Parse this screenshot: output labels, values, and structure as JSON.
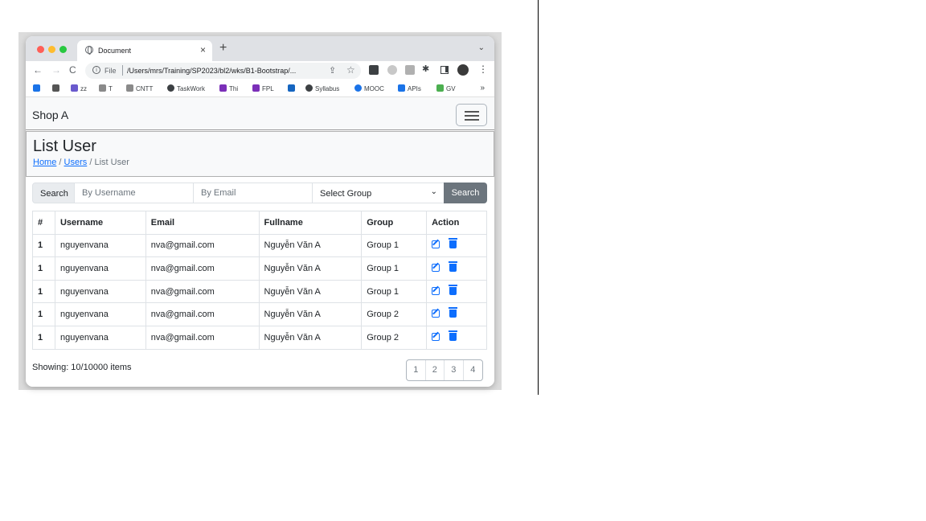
{
  "browser": {
    "tab_title": "Document",
    "new_tab": "+",
    "close": "×",
    "tab_menu": "⌄",
    "nav": {
      "back": "←",
      "forward": "→",
      "reload": "C"
    },
    "omnibox": {
      "info": "i",
      "scheme": "File",
      "url": "/Users/mrs/Training/SP2023/bl2/wks/B1-Bootstrap/..."
    },
    "bookmarks": [
      {
        "label": "",
        "color": "#1a73e8"
      },
      {
        "label": "",
        "color": "#555555"
      },
      {
        "label": "zz",
        "color": "#6a5acd"
      },
      {
        "label": "T",
        "color": "#6f6f6f"
      },
      {
        "label": "CNTT",
        "color": "#6f6f6f"
      },
      {
        "label": "TaskWork",
        "color": "#3c4043"
      },
      {
        "label": "Thi",
        "color": "#7b2fb8"
      },
      {
        "label": "FPL",
        "color": "#7b2fb8"
      },
      {
        "label": "",
        "color": "#1565c0"
      },
      {
        "label": "Syllabus",
        "color": "#3c4043"
      },
      {
        "label": "MOOC",
        "color": "#1a73e8"
      },
      {
        "label": "APIs",
        "color": "#1a73e8"
      },
      {
        "label": "GV",
        "color": "#4caf50"
      }
    ],
    "bookmarks_more": "»"
  },
  "navbar": {
    "brand": "Shop A"
  },
  "header": {
    "title": "List User",
    "breadcrumb": {
      "home": "Home",
      "users": "Users",
      "current": "List User",
      "sep": "/"
    }
  },
  "search": {
    "label": "Search",
    "username_placeholder": "By Username",
    "email_placeholder": "By Email",
    "group_selected": "Select Group",
    "button": "Search"
  },
  "table": {
    "headers": [
      "#",
      "Username",
      "Email",
      "Fullname",
      "Group",
      "Action"
    ],
    "rows": [
      {
        "num": "1",
        "username": "nguyenvana",
        "email": "nva@gmail.com",
        "fullname": "Nguyễn Văn A",
        "group": "Group 1"
      },
      {
        "num": "1",
        "username": "nguyenvana",
        "email": "nva@gmail.com",
        "fullname": "Nguyễn Văn A",
        "group": "Group 1"
      },
      {
        "num": "1",
        "username": "nguyenvana",
        "email": "nva@gmail.com",
        "fullname": "Nguyễn Văn A",
        "group": "Group 1"
      },
      {
        "num": "1",
        "username": "nguyenvana",
        "email": "nva@gmail.com",
        "fullname": "Nguyễn Văn A",
        "group": "Group 2"
      },
      {
        "num": "1",
        "username": "nguyenvana",
        "email": "nva@gmail.com",
        "fullname": "Nguyễn Văn A",
        "group": "Group 2"
      }
    ]
  },
  "footer": {
    "showing": "Showing: 10/10000 items",
    "pages": [
      "1",
      "2",
      "3",
      "4"
    ]
  }
}
